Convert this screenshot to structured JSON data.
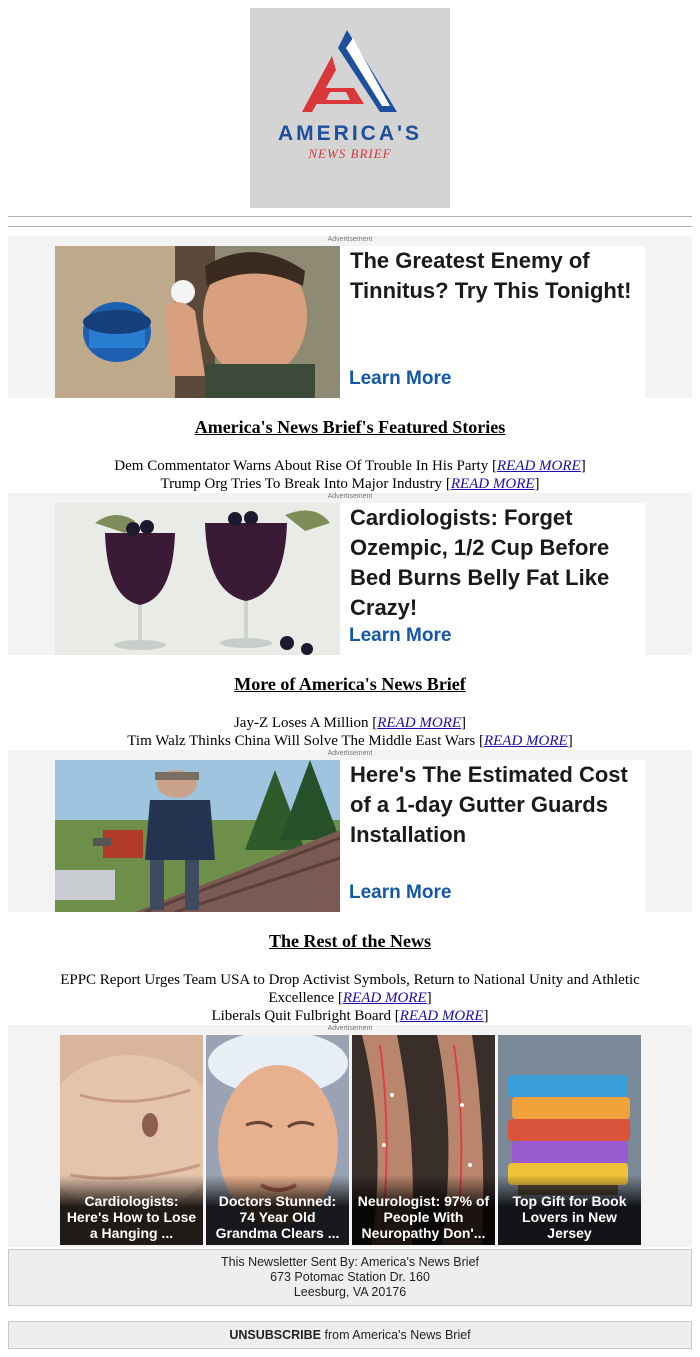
{
  "logo": {
    "word": "AMERICA'S",
    "sub": "NEWS BRIEF"
  },
  "ads": [
    {
      "label": "Advertisement",
      "headline": "The Greatest Enemy of Tinnitus? Try This Tonight!",
      "cta": "Learn More",
      "image": "man-with-vapor-rub-at-ear"
    },
    {
      "label": "Advertisement",
      "headline": "Cardiologists: Forget Ozempic, 1/2 Cup Before Bed Burns Belly Fat Like Crazy!",
      "cta": "Learn More",
      "image": "blueberry-drinks-in-wine-glasses"
    },
    {
      "label": "Advertisement",
      "headline": "Here's The Estimated Cost of a 1-day Gutter Guards Installation",
      "cta": "Learn More",
      "image": "man-drilling-on-roof"
    }
  ],
  "sections": [
    {
      "title": "America's News Brief's Featured Stories",
      "stories": [
        {
          "text": "Dem Commentator Warns About Rise Of Trouble In His Party",
          "link": "READ MORE"
        },
        {
          "text": "Trump Org Tries To Break Into Major Industry",
          "link": "READ MORE"
        }
      ]
    },
    {
      "title": "More of America's News Brief",
      "stories": [
        {
          "text": "Jay-Z Loses A Million",
          "link": "READ MORE"
        },
        {
          "text": "Tim Walz Thinks China Will Solve The Middle East Wars",
          "link": "READ MORE"
        }
      ]
    },
    {
      "title": "The Rest of the News",
      "stories": [
        {
          "text": "EPPC Report Urges Team USA to Drop Activist Symbols, Return to National Unity and Athletic Excellence",
          "link": "READ MORE"
        },
        {
          "text": "Liberals Quit Fulbright Board",
          "link": "READ MORE"
        }
      ]
    }
  ],
  "grid": {
    "label": "Advertisement",
    "tiles": [
      {
        "caption": "Cardiologists: Here's How to Lose a Hanging ...",
        "image": "belly-skin"
      },
      {
        "caption": "Doctors Stunned: 74 Year Old Grandma Clears ...",
        "image": "woman-face-mask"
      },
      {
        "caption": "Neurologist: 97% of People With Neuropathy Don'...",
        "image": "feet-nerves"
      },
      {
        "caption": "Top Gift for Book Lovers in New Jersey",
        "image": "glowing-book-lamp"
      }
    ]
  },
  "footer": {
    "line1": "This Newsletter Sent By: America's News Brief",
    "line2": "673 Potomac Station Dr. 160",
    "line3": "Leesburg, VA 20176"
  },
  "unsubscribe": {
    "action": "UNSUBSCRIBE",
    "rest": " from America's News Brief"
  },
  "colors": {
    "logo_blue": "#1d4f9c",
    "logo_red": "#d9373b",
    "link": "#1a0dab",
    "cta": "#1457a8",
    "band": "#f3f3f3"
  }
}
